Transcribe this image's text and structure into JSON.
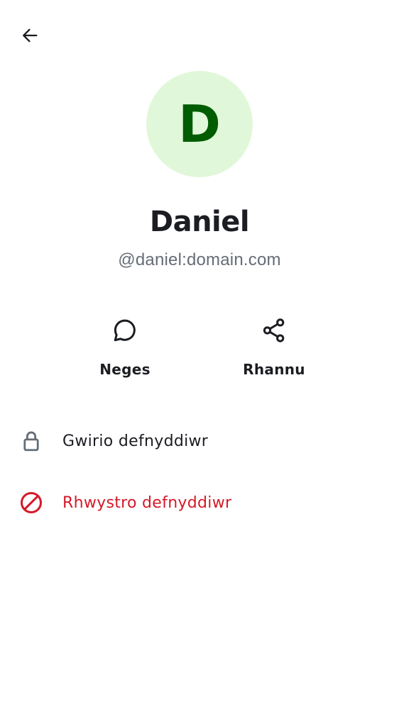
{
  "header": {
    "back_icon": "arrow-left-icon"
  },
  "profile": {
    "avatar_initial": "D",
    "avatar_bg_color": "#e0f8d9",
    "avatar_text_color": "#005c00",
    "display_name": "Daniel",
    "user_id": "@daniel:domain.com"
  },
  "actions": [
    {
      "label": "Neges",
      "icon": "chat-bubble-icon"
    },
    {
      "label": "Rhannu",
      "icon": "share-icon"
    }
  ],
  "options": [
    {
      "label": "Gwirio defnyddiwr",
      "icon": "lock-icon",
      "color": "#1b1d22"
    },
    {
      "label": "Rhwystro defnyddiwr",
      "icon": "block-icon",
      "color": "#d51928"
    }
  ],
  "colors": {
    "text_primary": "#1b1d22",
    "text_secondary": "#656d77",
    "icon_secondary": "#656d77",
    "critical": "#d51928"
  }
}
